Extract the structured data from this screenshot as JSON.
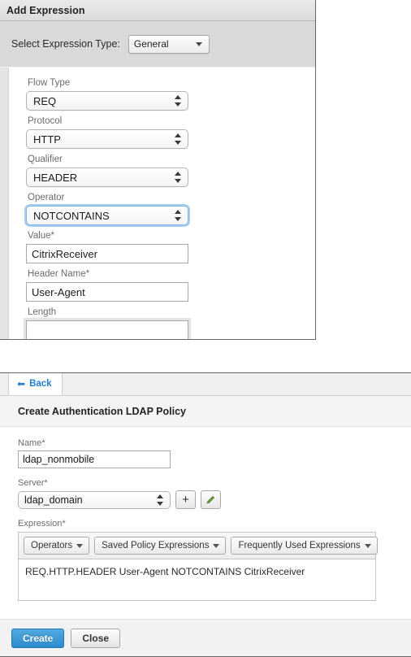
{
  "add_expression_panel": {
    "header_title": "Add Expression",
    "expression_type": {
      "label": "Select Expression Type:",
      "value": "General",
      "icon": "chevron-down-icon"
    },
    "fields": [
      {
        "label": "Flow Type",
        "value": "REQ",
        "control": "select",
        "icon": "stepper-arrows-icon",
        "focused": false
      },
      {
        "label": "Protocol",
        "value": "HTTP",
        "control": "select",
        "icon": "stepper-arrows-icon",
        "focused": false
      },
      {
        "label": "Qualifier",
        "value": "HEADER",
        "control": "select",
        "icon": "stepper-arrows-icon",
        "focused": false
      },
      {
        "label": "Operator",
        "value": "NOTCONTAINS",
        "control": "select",
        "icon": "stepper-arrows-icon",
        "focused": true
      },
      {
        "label": "Value*",
        "value": "CitrixReceiver",
        "control": "text",
        "focused": false
      },
      {
        "label": "Header Name*",
        "value": "User-Agent",
        "control": "text",
        "focused": false
      },
      {
        "label": "Length",
        "value": "",
        "control": "text",
        "focused": false
      }
    ]
  },
  "ldap_policy_panel": {
    "tab": {
      "back_label": "Back",
      "back_icon": "arrow-left-icon"
    },
    "title": "Create Authentication LDAP Policy",
    "name_field": {
      "label": "Name*",
      "value": "ldap_nonmobile"
    },
    "server_field": {
      "label": "Server*",
      "value": "ldap_domain",
      "select_icon": "stepper-arrows-icon",
      "add_button_icon": "plus-icon",
      "edit_button_icon": "pencil-icon"
    },
    "expression_field": {
      "label": "Expression*",
      "toolbar": [
        {
          "label": "Operators",
          "icon": "chevron-down-icon"
        },
        {
          "label": "Saved Policy Expressions",
          "icon": "chevron-down-icon"
        },
        {
          "label": "Frequently Used Expressions",
          "icon": "chevron-down-icon"
        }
      ],
      "value": "REQ.HTTP.HEADER User-Agent NOTCONTAINS CitrixReceiver"
    },
    "footer": {
      "create_label": "Create",
      "close_label": "Close"
    }
  },
  "colors": {
    "primary_button": "#2b8bcd",
    "link_blue": "#1d7fd0",
    "focus_ring": "#aaccee",
    "panel_border": "#666666"
  }
}
